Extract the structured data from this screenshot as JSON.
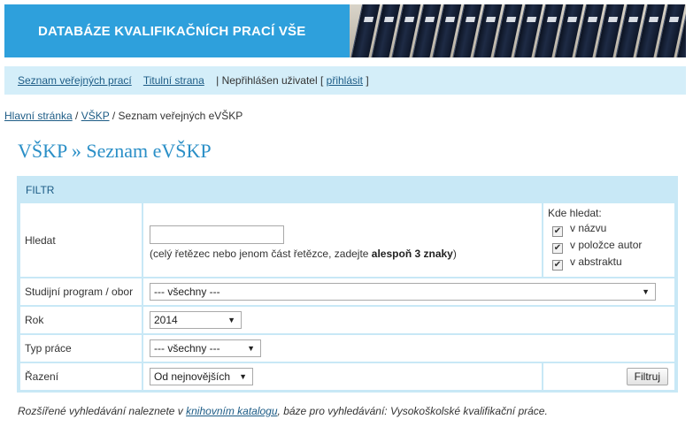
{
  "banner": {
    "title": "DATABÁZE KVALIFIKAČNÍCH PRACÍ VŠE"
  },
  "nav": {
    "link_public": "Seznam veřejných prací",
    "link_home": "Titulní strana",
    "user_prefix": "| Nepřihlášen uživatel [",
    "login": "přihlásit",
    "user_suffix": "]"
  },
  "breadcrumb": {
    "home": "Hlavní stránka",
    "sep1": " / ",
    "vskp": "VŠKP",
    "sep2": " / ",
    "current": "Seznam veřejných eVŠKP"
  },
  "page": {
    "title": "VŠKP » Seznam eVŠKP"
  },
  "filter": {
    "header": "FILTR",
    "search": {
      "label": "Hledat",
      "value": "",
      "hint_prefix": "(celý řetězec nebo jenom část řetězce, zadejte ",
      "hint_bold": "alespoň 3 znaky",
      "hint_suffix": ")"
    },
    "where": {
      "label": "Kde hledat:",
      "options": [
        {
          "label": "v názvu",
          "checked": true
        },
        {
          "label": "v položce autor",
          "checked": true
        },
        {
          "label": "v abstraktu",
          "checked": true
        }
      ]
    },
    "program": {
      "label": "Studijní program / obor",
      "selected": "--- všechny ---"
    },
    "year": {
      "label": "Rok",
      "selected": "2014"
    },
    "type": {
      "label": "Typ práce",
      "selected": "--- všechny ---"
    },
    "sort": {
      "label": "Řazení",
      "selected": "Od nejnovějších"
    },
    "submit_label": "Filtruj"
  },
  "footer": {
    "prefix": "Rozšířené vyhledávání naleznete v ",
    "link": "knihovním katalogu",
    "suffix": ", báze pro vyhledávání: Vysokoškolské kvalifikační práce."
  },
  "icons": {
    "dropdown": "triangle-down-icon",
    "check": "checkmark-icon"
  },
  "colors": {
    "banner": "#2ea0dc",
    "navbar": "#d4eef9",
    "title": "#2a8fc7",
    "grid": "#c8e8f6",
    "link": "#1d5c86"
  }
}
